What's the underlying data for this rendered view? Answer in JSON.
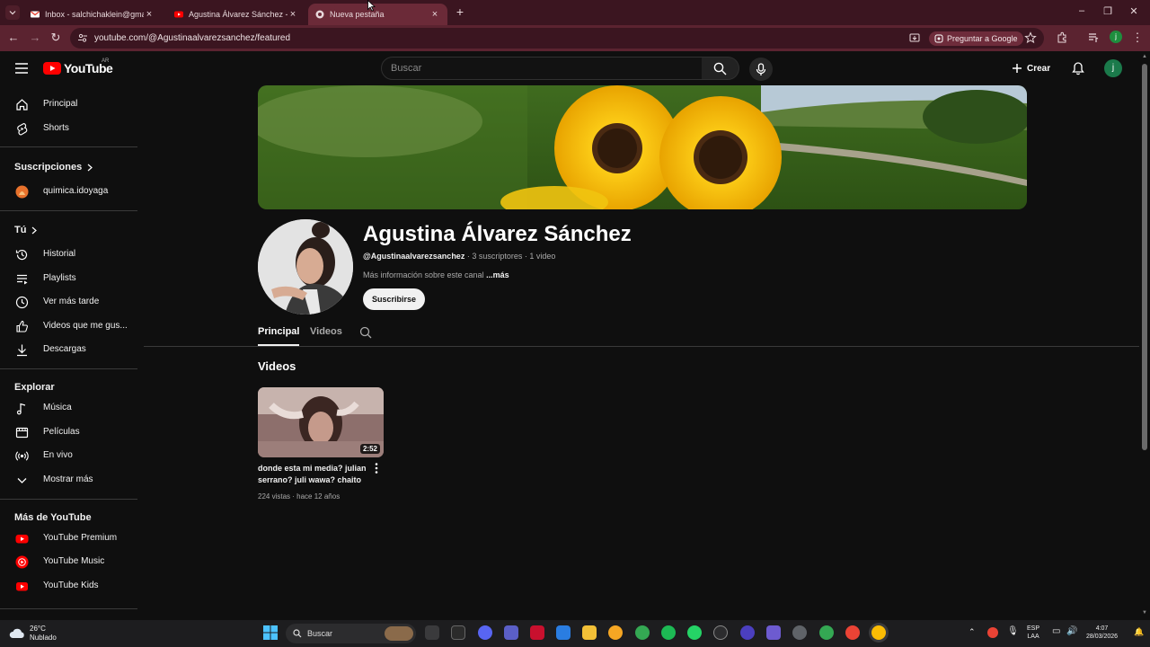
{
  "browser": {
    "tabs": [
      {
        "title": "Inbox - salchichaklein@gmail.co"
      },
      {
        "title": "Agustina Álvarez Sánchez - You"
      },
      {
        "title": "Nueva pestaña"
      }
    ],
    "url": "youtube.com/@Agustinaalvarezsanchez/featured",
    "ask_google_label": "Preguntar a Google",
    "profile_initial": "j"
  },
  "yt_header": {
    "logo_text": "YouTube",
    "country_code": "AR",
    "search_placeholder": "Buscar",
    "create_label": "Crear",
    "avatar_initial": "j"
  },
  "sidebar": {
    "main": [
      {
        "label": "Principal",
        "icon": "home-icon"
      },
      {
        "label": "Shorts",
        "icon": "shorts-icon"
      }
    ],
    "subscriptions_heading": "Suscripciones",
    "subscriptions": [
      {
        "label": "quimica.idoyaga",
        "icon": "channel-avatar"
      }
    ],
    "you_heading": "Tú",
    "you": [
      {
        "label": "Historial",
        "icon": "history-icon"
      },
      {
        "label": "Playlists",
        "icon": "playlists-icon"
      },
      {
        "label": "Ver más tarde",
        "icon": "watch-later-icon"
      },
      {
        "label": "Videos que me gus...",
        "icon": "liked-icon"
      },
      {
        "label": "Descargas",
        "icon": "download-icon"
      }
    ],
    "explore_heading": "Explorar",
    "explore": [
      {
        "label": "Música",
        "icon": "music-icon"
      },
      {
        "label": "Películas",
        "icon": "movies-icon"
      },
      {
        "label": "En vivo",
        "icon": "live-icon"
      },
      {
        "label": "Mostrar más",
        "icon": "chevron-down-icon"
      }
    ],
    "more_heading": "Más de YouTube",
    "more": [
      {
        "label": "YouTube Premium",
        "icon": "youtube-premium-icon"
      },
      {
        "label": "YouTube Music",
        "icon": "youtube-music-icon"
      },
      {
        "label": "YouTube Kids",
        "icon": "youtube-kids-icon"
      }
    ]
  },
  "channel": {
    "name": "Agustina Álvarez Sánchez",
    "handle": "@Agustinaalvarezsanchez",
    "subscribers": "3 suscriptores",
    "videos_count": "1 video",
    "description": "Más información sobre este canal",
    "more_link": "...más",
    "subscribe_label": "Suscribirse",
    "tabs": [
      {
        "label": "Principal",
        "active": true
      },
      {
        "label": "Videos",
        "active": false
      }
    ],
    "section_title": "Videos",
    "videos": [
      {
        "title": "donde esta mi media? julian serrano? juli wawa? chaito",
        "duration": "2:52",
        "views": "224 vistas",
        "age": "hace 12 años"
      }
    ]
  },
  "taskbar": {
    "temperature": "26°C",
    "weather": "Nublado",
    "search_label": "Buscar",
    "language": "ESP",
    "layout": "LAA",
    "time": "4:07",
    "date": "28/03/2026"
  },
  "colors": {
    "tab_bar": "#3b1520",
    "address_bar": "#5b2330",
    "yt_background": "#0f0f0f",
    "yt_red": "#ff0000"
  }
}
